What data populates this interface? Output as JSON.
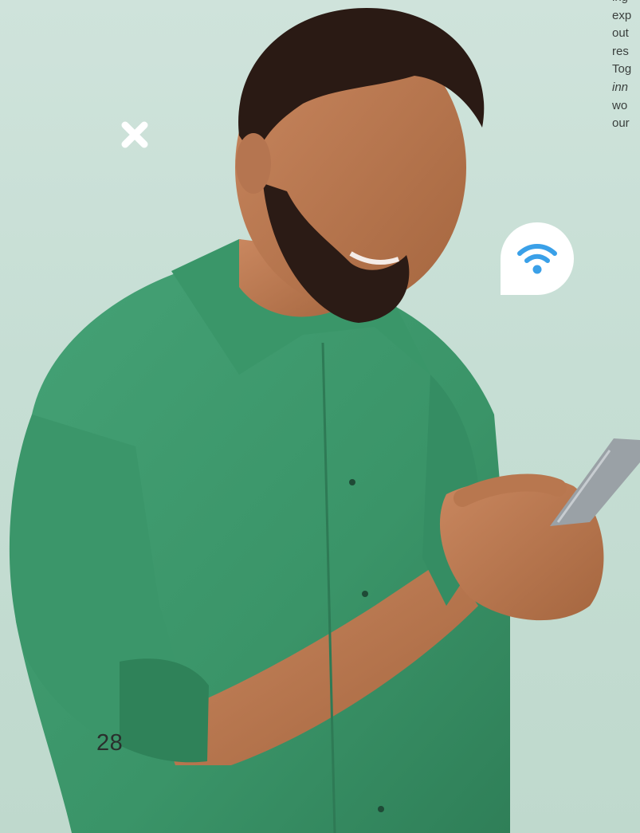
{
  "body_text": {
    "lines": [
      "ing",
      "exp",
      "out",
      "res",
      "Tog",
      "inn",
      "wo",
      "our"
    ]
  },
  "icons": {
    "close": "close-icon",
    "wifi": "wifi-icon"
  },
  "colors": {
    "background": "#c6ded4",
    "shirt": "#3f9a6f",
    "wifi_icon": "#3aa0e8",
    "badge": "#ffffff"
  },
  "page_number": "28"
}
